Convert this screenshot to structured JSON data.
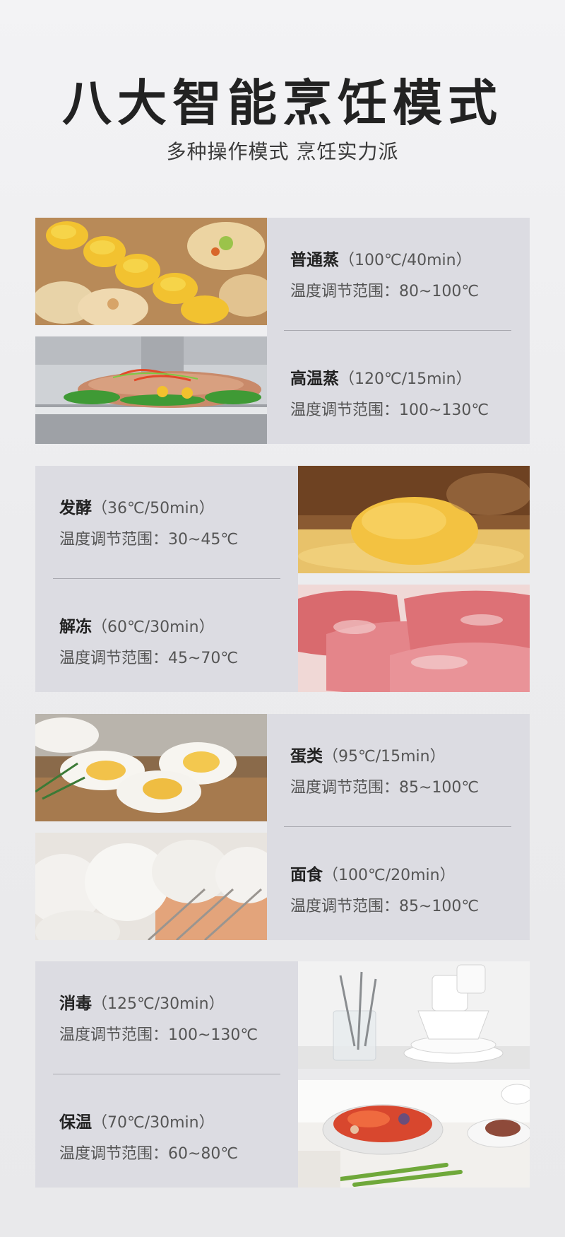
{
  "header": {
    "title": "八大智能烹饪模式",
    "subtitle": "多种操作模式 烹饪实力派"
  },
  "modes": [
    {
      "name": "普通蒸",
      "detail": "（100℃/40min）",
      "range": "温度调节范围：80~100℃",
      "image": "corn-scallops-photo"
    },
    {
      "name": "高温蒸",
      "detail": "（120℃/15min）",
      "range": "温度调节范围：100~130℃",
      "image": "steamed-fish-photo"
    },
    {
      "name": "发酵",
      "detail": "（36℃/50min）",
      "range": "温度调节范围：30~45℃",
      "image": "dough-photo"
    },
    {
      "name": "解冻",
      "detail": "（60℃/30min）",
      "range": "温度调节范围：45~70℃",
      "image": "frozen-meat-photo"
    },
    {
      "name": "蛋类",
      "detail": "（95℃/15min）",
      "range": "温度调节范围：85~100℃",
      "image": "boiled-eggs-photo"
    },
    {
      "name": "面食",
      "detail": "（100℃/20min）",
      "range": "温度调节范围：85~100℃",
      "image": "steamed-buns-photo"
    },
    {
      "name": "消毒",
      "detail": "（125℃/30min）",
      "range": "温度调节范围：100~130℃",
      "image": "tableware-photo"
    },
    {
      "name": "保温",
      "detail": "（70℃/30min）",
      "range": "温度调节范围：60~80℃",
      "image": "seafood-platter-photo"
    }
  ],
  "colors": {
    "panel": "#dcdce2",
    "title": "#222222",
    "divider": "#a9a9b0"
  }
}
